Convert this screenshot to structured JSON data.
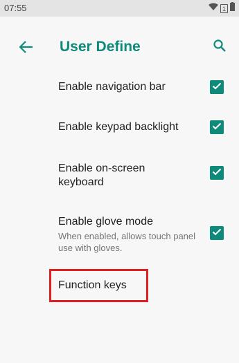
{
  "status_bar": {
    "time": "07:55",
    "sim_label": "1"
  },
  "app_bar": {
    "title": "User Define",
    "back_icon": "arrow-left-icon",
    "search_icon": "search-icon"
  },
  "preferences": [
    {
      "title": "Enable navigation bar",
      "summary": "",
      "checked": true
    },
    {
      "title": "Enable keypad backlight",
      "summary": "",
      "checked": true
    },
    {
      "title": "Enable on-screen keyboard",
      "summary": "",
      "checked": true
    },
    {
      "title": "Enable glove mode",
      "summary": "When enabled, allows touch panel use with gloves.",
      "checked": true
    },
    {
      "title": "Function keys",
      "summary": "",
      "checked": null
    }
  ],
  "colors": {
    "accent": "#0e8a7a",
    "highlight": "#e02020",
    "background": "#f7f7f7"
  }
}
